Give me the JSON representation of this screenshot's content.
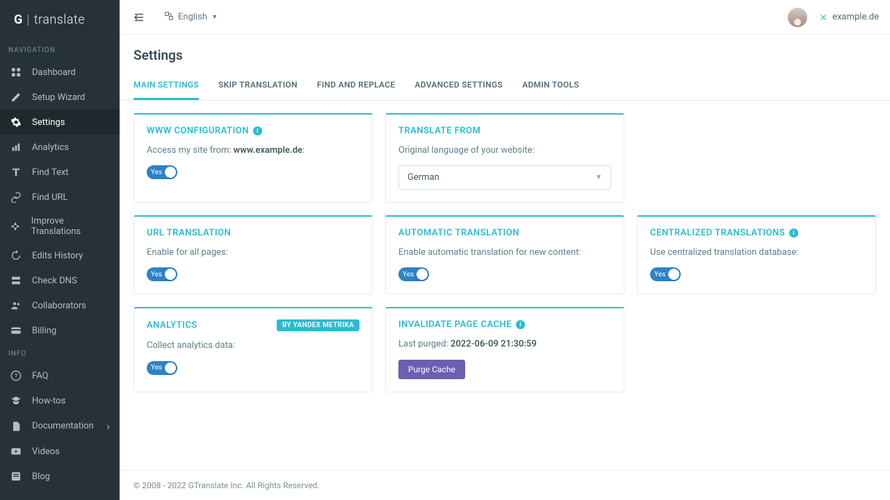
{
  "logo": {
    "g": "G",
    "text": "translate"
  },
  "nav": {
    "heading1": "NAVIGATION",
    "heading2": "INFO",
    "items1": [
      "Dashboard",
      "Setup Wizard",
      "Settings",
      "Analytics",
      "Find Text",
      "Find URL",
      "Improve Translations",
      "Edits History",
      "Check DNS",
      "Collaborators",
      "Billing"
    ],
    "items2": [
      "FAQ",
      "How-tos",
      "Documentation",
      "Videos",
      "Blog"
    ]
  },
  "topbar": {
    "language": "English",
    "domain": "example.de"
  },
  "page": {
    "title": "Settings"
  },
  "tabs": [
    "MAIN SETTINGS",
    "SKIP TRANSLATION",
    "FIND AND REPLACE",
    "ADVANCED SETTINGS",
    "ADMIN TOOLS"
  ],
  "cards": {
    "www": {
      "title": "WWW CONFIGURATION",
      "desc_pre": "Access my site from: ",
      "desc_bold": "www.example.de",
      "desc_post": ":",
      "toggle": "Yes"
    },
    "from": {
      "title": "TRANSLATE FROM",
      "desc": "Original language of your website:",
      "value": "German"
    },
    "url": {
      "title": "URL TRANSLATION",
      "desc": "Enable for all pages:",
      "toggle": "Yes"
    },
    "auto": {
      "title": "AUTOMATIC TRANSLATION",
      "desc": "Enable automatic translation for new content:",
      "toggle": "Yes"
    },
    "central": {
      "title": "CENTRALIZED TRANSLATIONS",
      "desc": "Use centralized translation database:",
      "toggle": "Yes"
    },
    "analytics": {
      "title": "ANALYTICS",
      "badge": "BY YANDEX METRIKA",
      "desc": "Collect analytics data:",
      "toggle": "Yes"
    },
    "cache": {
      "title": "INVALIDATE PAGE CACHE",
      "desc_pre": "Last purged: ",
      "desc_bold": "2022-06-09 21:30:59",
      "button": "Purge Cache"
    }
  },
  "footer": "© 2008 - 2022 GTranslate Inc. All Rights Reserved."
}
